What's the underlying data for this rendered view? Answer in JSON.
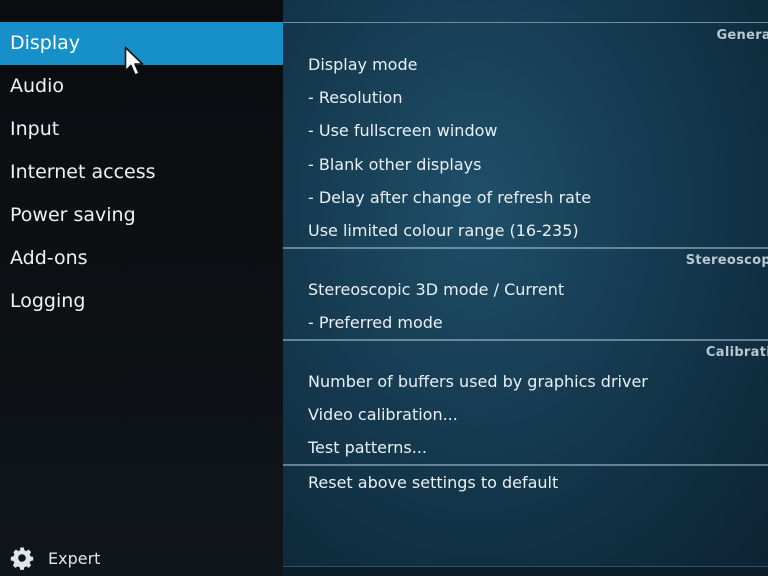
{
  "sidebar": {
    "items": [
      {
        "label": "Display"
      },
      {
        "label": "Audio"
      },
      {
        "label": "Input"
      },
      {
        "label": "Internet access"
      },
      {
        "label": "Power saving"
      },
      {
        "label": "Add-ons"
      },
      {
        "label": "Logging"
      }
    ],
    "active_index": 0,
    "expert_label": "Expert"
  },
  "sections": [
    {
      "header": "Genera",
      "rows": [
        "Display mode",
        "- Resolution",
        "- Use fullscreen window",
        "- Blank other displays",
        "- Delay after change of refresh rate",
        "Use limited colour range (16-235)"
      ]
    },
    {
      "header": "Stereoscop",
      "rows": [
        "Stereoscopic 3D mode / Current",
        "- Preferred mode"
      ]
    },
    {
      "header": "Calibrati",
      "rows": [
        "Number of buffers used by graphics driver",
        "Video calibration...",
        "Test patterns..."
      ]
    }
  ],
  "reset_label": "Reset above settings to default",
  "colors": {
    "accent": "#1790c9",
    "sidebar_bg": "#0d1114",
    "panel_bg": "#153a50"
  }
}
